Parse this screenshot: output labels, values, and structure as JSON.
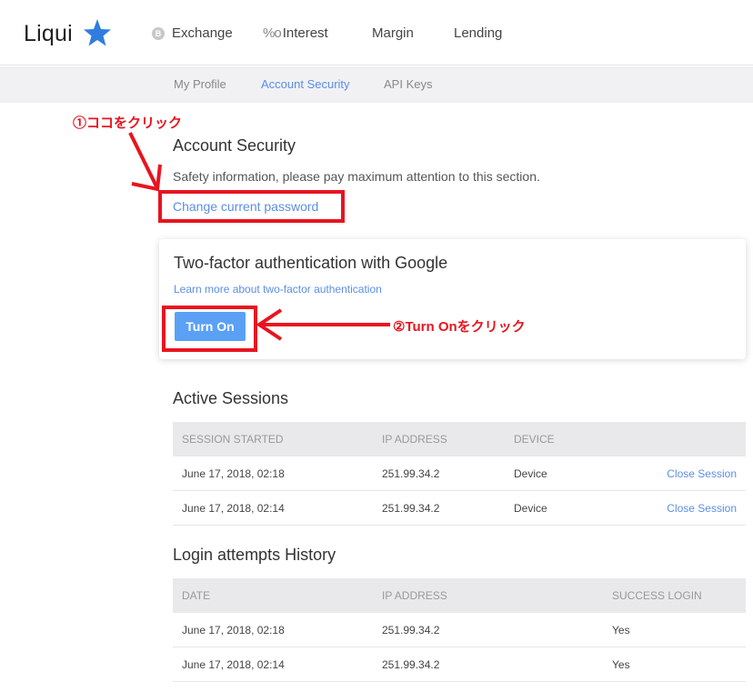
{
  "header": {
    "logo": "Liqui",
    "logo_icon": "star-icon",
    "nav": [
      {
        "label": "Exchange",
        "icon": "bitcoin-icon"
      },
      {
        "label": "Interest",
        "icon": "percent-icon"
      },
      {
        "label": "Margin"
      },
      {
        "label": "Lending"
      }
    ]
  },
  "subnav": {
    "items": [
      "My Profile",
      "Account Security",
      "API Keys"
    ],
    "active": "Account Security"
  },
  "security": {
    "title": "Account Security",
    "description": "Safety information, please pay maximum attention to this section.",
    "change_password": "Change current password"
  },
  "two_factor": {
    "title": "Two-factor authentication with Google",
    "learn_more": "Learn more about two-factor authentication",
    "button": "Turn On"
  },
  "annotations": {
    "step1": "①ココをクリック",
    "step2": "②Turn Onをクリック",
    "color": "#e8141f"
  },
  "active_sessions": {
    "title": "Active Sessions",
    "columns": [
      "SESSION STARTED",
      "IP ADDRESS",
      "DEVICE"
    ],
    "rows": [
      {
        "started": "June 17, 2018, 02:18",
        "ip": "251.99.34.2",
        "device": "Device",
        "action": "Close Session"
      },
      {
        "started": "June 17, 2018, 02:14",
        "ip": "251.99.34.2",
        "device": "Device",
        "action": "Close Session"
      }
    ]
  },
  "login_history": {
    "title": "Login attempts History",
    "columns": [
      "DATE",
      "IP ADDRESS",
      "SUCCESS LOGIN"
    ],
    "rows": [
      {
        "date": "June 17, 2018, 02:18",
        "ip": "251.99.34.2",
        "success": "Yes"
      },
      {
        "date": "June 17, 2018, 02:14",
        "ip": "251.99.34.2",
        "success": "Yes"
      }
    ]
  },
  "colors": {
    "accent": "#5b8ee6",
    "button": "#5aa0f5",
    "logo_star": "#2f7de1"
  }
}
